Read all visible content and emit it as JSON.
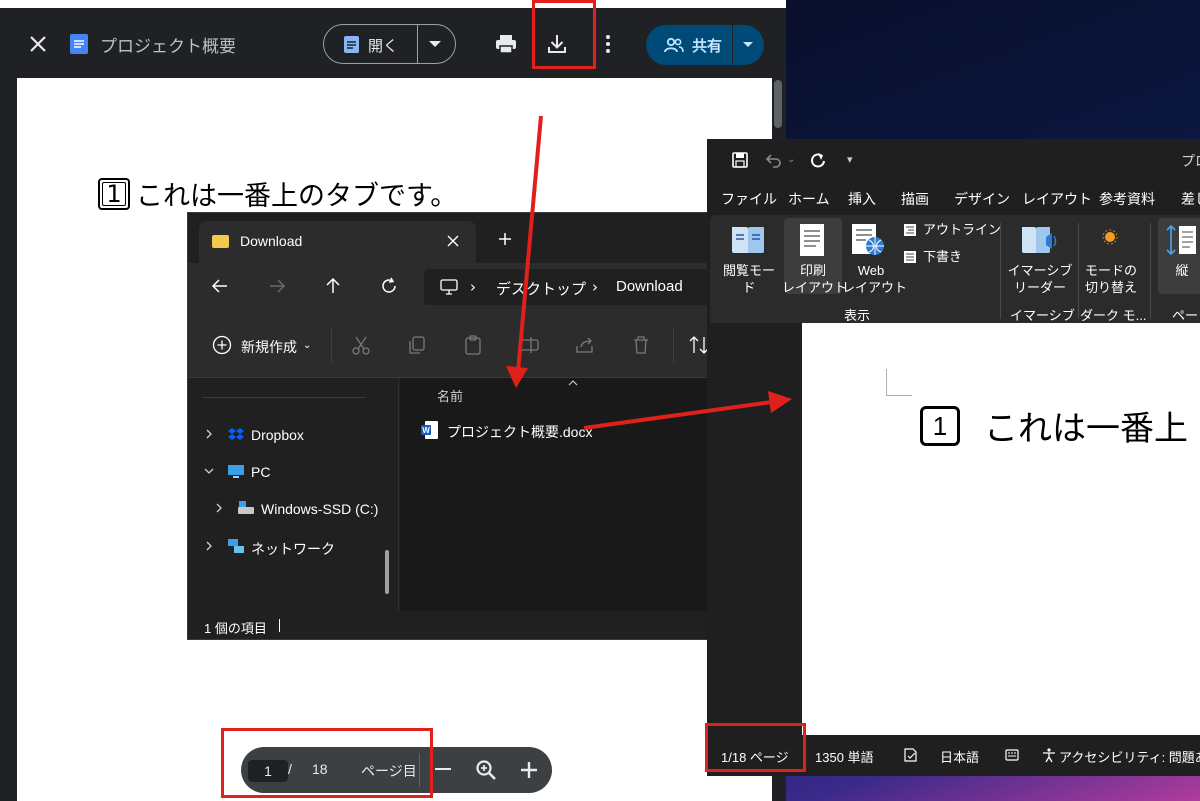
{
  "preview": {
    "title": "プロジェクト概要",
    "open_label": "開く",
    "share_label": "共有",
    "doc_number": "1",
    "doc_text": "これは一番上のタブです。",
    "pager": {
      "current": "1",
      "separator": "/",
      "total": "18",
      "unit": "ページ目"
    }
  },
  "explorer": {
    "tab_title": "Download",
    "breadcrumb": [
      "デスクトップ",
      "Download"
    ],
    "new_label": "新規作成",
    "sidebar": [
      {
        "label": "Dropbox",
        "icon": "dropbox-icon"
      },
      {
        "label": "PC",
        "icon": "pc-icon"
      },
      {
        "label": "Windows-SSD (C:)",
        "icon": "drive-icon"
      },
      {
        "label": "ネットワーク",
        "icon": "network-icon"
      }
    ],
    "column_header": "名前",
    "files": [
      {
        "name": "プロジェクト概要.docx",
        "icon": "word-file-icon"
      }
    ],
    "status": "1 個の項目"
  },
  "word": {
    "title_fragment": "プロ",
    "tabs": [
      "ファイル",
      "ホーム",
      "挿入",
      "描画",
      "デザイン",
      "レイアウト",
      "参考資料",
      "差し"
    ],
    "ribbon": {
      "read_mode": "閲覧モード",
      "print_layout": "印刷\nレイアウト",
      "web_layout": "Web\nレイアウト",
      "outline": "アウトライン",
      "draft": "下書き",
      "group_view": "表示",
      "immersive_reader": "イマーシブ\nリーダー",
      "group_immersive": "イマーシブ",
      "mode_switch": "モードの\n切り替え",
      "group_dark": "ダーク モ...",
      "vertical": "縦",
      "group_page": "ペー"
    },
    "doc_number": "1",
    "doc_text": "これは一番上",
    "status": {
      "page": "1/18 ページ",
      "words": "1350 単語",
      "language": "日本語",
      "accessibility": "アクセシビリティ: 問題ありま"
    }
  },
  "colors": {
    "highlight": "#e0201b",
    "share_button": "#004a77",
    "folder": "#f2c94c"
  }
}
